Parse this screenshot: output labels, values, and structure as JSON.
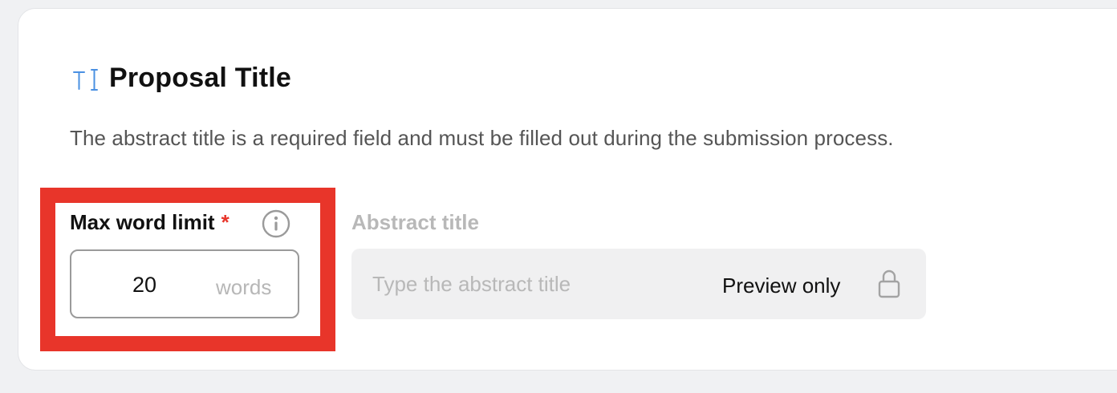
{
  "section": {
    "title": "Proposal Title",
    "title_icon": "text-cursor-icon",
    "description": "The abstract title is a required field and must be filled out during the submission process."
  },
  "word_limit": {
    "label": "Max word limit",
    "required_marker": "*",
    "info_icon": "info-icon",
    "value": "20",
    "suffix": "words"
  },
  "abstract_title": {
    "label": "Abstract title",
    "placeholder": "Type the abstract title",
    "preview_text": "Preview only",
    "lock_icon": "lock-icon"
  },
  "colors": {
    "accent": "#4a90e2",
    "required": "#e8352a",
    "highlight": "#e8352a"
  }
}
